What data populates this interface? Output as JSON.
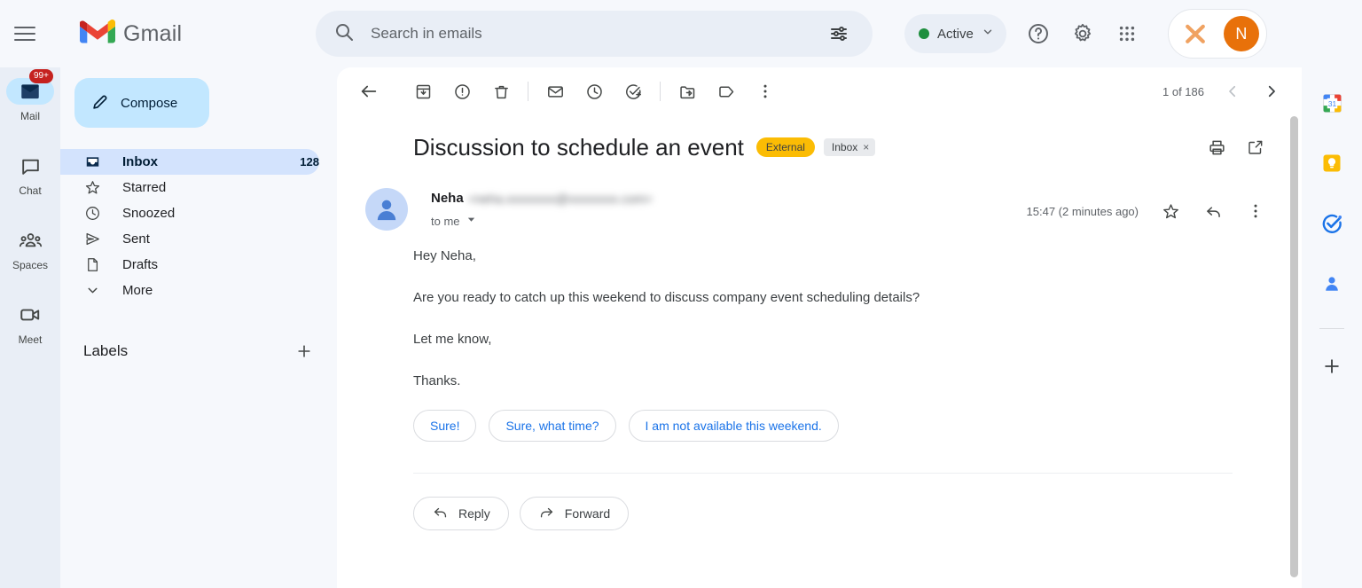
{
  "app": {
    "brand": "Gmail",
    "menu_icon": "hamburger-icon"
  },
  "search": {
    "placeholder": "Search in emails",
    "value": "",
    "search_icon": "search-icon",
    "options_icon": "tune-options-icon"
  },
  "status": {
    "label": "Active",
    "dot_color": "#1e8e3e",
    "chevron": "chevron-down-icon"
  },
  "topbar": {
    "help_label": "Support",
    "settings_label": "Settings",
    "apps_label": "Google apps",
    "workspace_icon": "orange-cross-tools-icon",
    "avatar_initial": "N",
    "avatar_color": "#e8710a"
  },
  "rail": {
    "items": [
      {
        "label": "Mail",
        "icon": "mail-icon",
        "selected": true,
        "badge": "99+"
      },
      {
        "label": "Chat",
        "icon": "chat-bubble-icon",
        "selected": false,
        "badge": ""
      },
      {
        "label": "Spaces",
        "icon": "spaces-people-icon",
        "selected": false,
        "badge": ""
      },
      {
        "label": "Meet",
        "icon": "video-camera-icon",
        "selected": false,
        "badge": ""
      }
    ]
  },
  "sidebar": {
    "compose": "Compose",
    "compose_icon": "pencil-icon",
    "folders": [
      {
        "label": "Inbox",
        "count": "128",
        "icon": "inbox-icon",
        "selected": true
      },
      {
        "label": "Starred",
        "count": "",
        "icon": "star-icon",
        "selected": false
      },
      {
        "label": "Snoozed",
        "count": "",
        "icon": "clock-icon",
        "selected": false
      },
      {
        "label": "Sent",
        "count": "",
        "icon": "send-icon",
        "selected": false
      },
      {
        "label": "Drafts",
        "count": "",
        "icon": "draft-icon",
        "selected": false
      },
      {
        "label": "More",
        "count": "",
        "icon": "chevron-down-icon",
        "selected": false
      }
    ],
    "labels_title": "Labels",
    "labels_add_icon": "plus-icon"
  },
  "toolbar": {
    "back_label": "Back to Inbox",
    "archive_label": "Archive",
    "spam_label": "Report spam",
    "delete_label": "Delete",
    "unread_label": "Mark as unread",
    "snooze_label": "Snooze",
    "task_label": "Add to tasks",
    "move_label": "Move to",
    "labels_label": "Labels",
    "more_label": "More",
    "pagination": "1 of 186",
    "prev_label": "Newer",
    "next_label": "Older"
  },
  "email": {
    "subject": "Discussion to schedule an event",
    "badge_external": "External",
    "chip_inbox": "Inbox",
    "chip_close": "×",
    "print_label": "Print all",
    "popout_label": "Open in new window",
    "sender_name": "Neha",
    "sender_email": "<neha.xxxxxxxx@xxxxxxxx.com>",
    "recipient": "to me",
    "timestamp": "15:47 (2 minutes ago)",
    "star_label": "Star",
    "reply_icon_label": "Reply",
    "more_label": "More",
    "body": [
      "Hey Neha,",
      "Are you ready to catch up this weekend to discuss company event scheduling details?",
      "Let me know,",
      "Thanks."
    ],
    "smart_replies": [
      "Sure!",
      "Sure, what time?",
      "I am not available this weekend."
    ],
    "reply_button": "Reply",
    "forward_button": "Forward"
  },
  "right_rail": {
    "items": [
      {
        "label": "Calendar",
        "icon": "google-calendar-icon",
        "day": "31"
      },
      {
        "label": "Keep",
        "icon": "google-keep-icon",
        "day": ""
      },
      {
        "label": "Tasks",
        "icon": "google-tasks-icon",
        "day": ""
      },
      {
        "label": "Contacts",
        "icon": "google-contacts-icon",
        "day": ""
      }
    ],
    "add_label": "Get add-ons",
    "add_icon": "plus-icon"
  }
}
